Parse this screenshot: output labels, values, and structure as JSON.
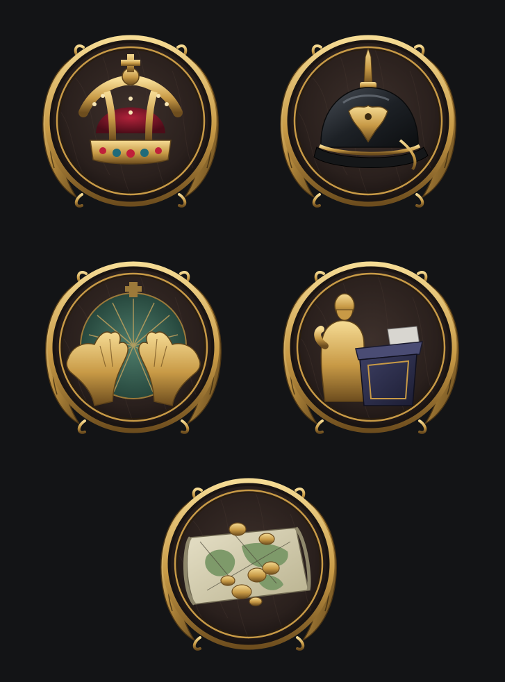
{
  "screen": {
    "background": "#131416"
  },
  "palette": {
    "gold_light": "#e8c77a",
    "gold_mid": "#b58a3c",
    "gold_dark": "#5e431a",
    "wood_light": "#3b2e29",
    "wood_dark": "#1c1513"
  },
  "badges": [
    {
      "id": "monarchy",
      "icon": "royal-crown-icon"
    },
    {
      "id": "militarism",
      "icon": "pickelhaube-helmet-icon"
    },
    {
      "id": "faith",
      "icon": "open-golden-hands-icon"
    },
    {
      "id": "oratory",
      "icon": "orator-at-podium-icon"
    },
    {
      "id": "trade",
      "icon": "map-with-gold-coins-icon"
    }
  ]
}
